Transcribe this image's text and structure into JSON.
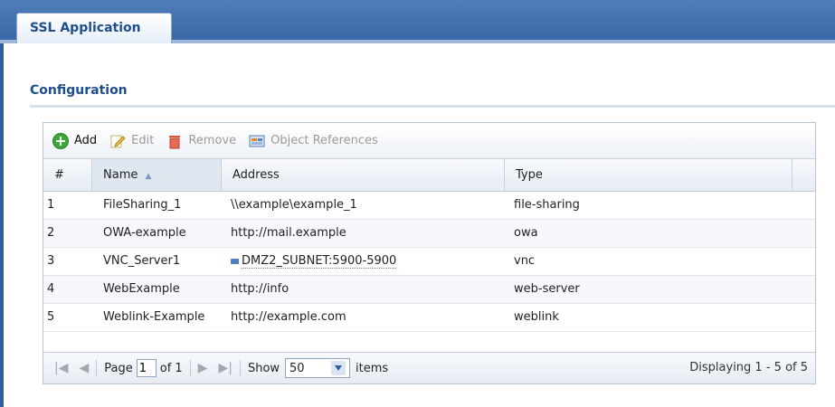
{
  "header": {
    "tab_label": "SSL Application"
  },
  "section": {
    "title": "Configuration"
  },
  "toolbar": {
    "add": "Add",
    "edit": "Edit",
    "remove": "Remove",
    "object_references": "Object References"
  },
  "table": {
    "columns": [
      "#",
      "Name",
      "Address",
      "Type"
    ],
    "sort_indicator": "▲",
    "rows": [
      {
        "num": "1",
        "name": "FileSharing_1",
        "address": "\\\\example\\example_1",
        "type": "file-sharing"
      },
      {
        "num": "2",
        "name": "OWA-example",
        "address": "http://mail.example",
        "type": "owa"
      },
      {
        "num": "3",
        "name": "VNC_Server1",
        "address": "DMZ2_SUBNET:5900-5900",
        "type": "vnc"
      },
      {
        "num": "4",
        "name": "WebExample",
        "address": "http://info",
        "type": "web-server"
      },
      {
        "num": "5",
        "name": "Weblink-Example",
        "address": "http://example.com",
        "type": "weblink"
      }
    ]
  },
  "pager": {
    "page_label": "Page",
    "page_value": "1",
    "of_label": "of 1",
    "show_label": "Show",
    "show_value": "50",
    "items_label": "items",
    "display_text": "Displaying 1 - 5 of 5"
  },
  "colors": {
    "tab_bar": "#3a69a8",
    "accent_text": "#1f4e8c",
    "add_icon": "#3aa83a"
  }
}
